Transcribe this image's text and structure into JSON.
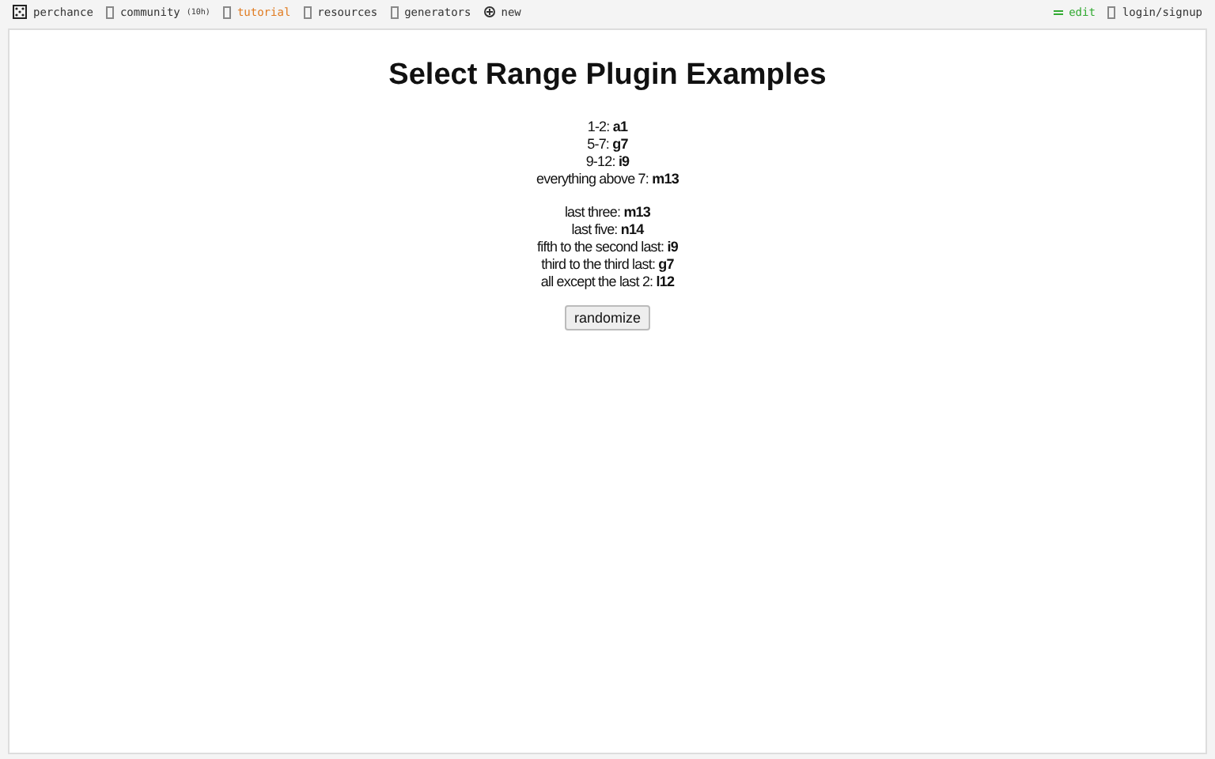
{
  "nav": {
    "items": [
      {
        "kind": "home",
        "label": "perchance",
        "selected": false
      },
      {
        "kind": "link",
        "label": "community",
        "badge": "(10h)",
        "selected": false
      },
      {
        "kind": "link",
        "label": "tutorial",
        "selected": true
      },
      {
        "kind": "link",
        "label": "resources",
        "selected": false
      },
      {
        "kind": "link",
        "label": "generators",
        "selected": false
      },
      {
        "kind": "new",
        "label": "new",
        "selected": false
      }
    ],
    "right": [
      {
        "kind": "edit",
        "label": "edit"
      },
      {
        "kind": "link",
        "label": "login/signup"
      }
    ]
  },
  "title": "Select Range Plugin Examples",
  "groups": [
    [
      {
        "label": "1-2:",
        "value": "a1"
      },
      {
        "label": "5-7:",
        "value": "g7"
      },
      {
        "label": "9-12:",
        "value": "i9"
      },
      {
        "label": "everything above 7:",
        "value": "m13"
      }
    ],
    [
      {
        "label": "last three:",
        "value": "m13"
      },
      {
        "label": "last five:",
        "value": "n14"
      },
      {
        "label": "fifth to the second last:",
        "value": "i9"
      },
      {
        "label": "third to the third last:",
        "value": "g7"
      },
      {
        "label": "all except the last 2:",
        "value": "l12"
      }
    ]
  ],
  "button": "randomize"
}
